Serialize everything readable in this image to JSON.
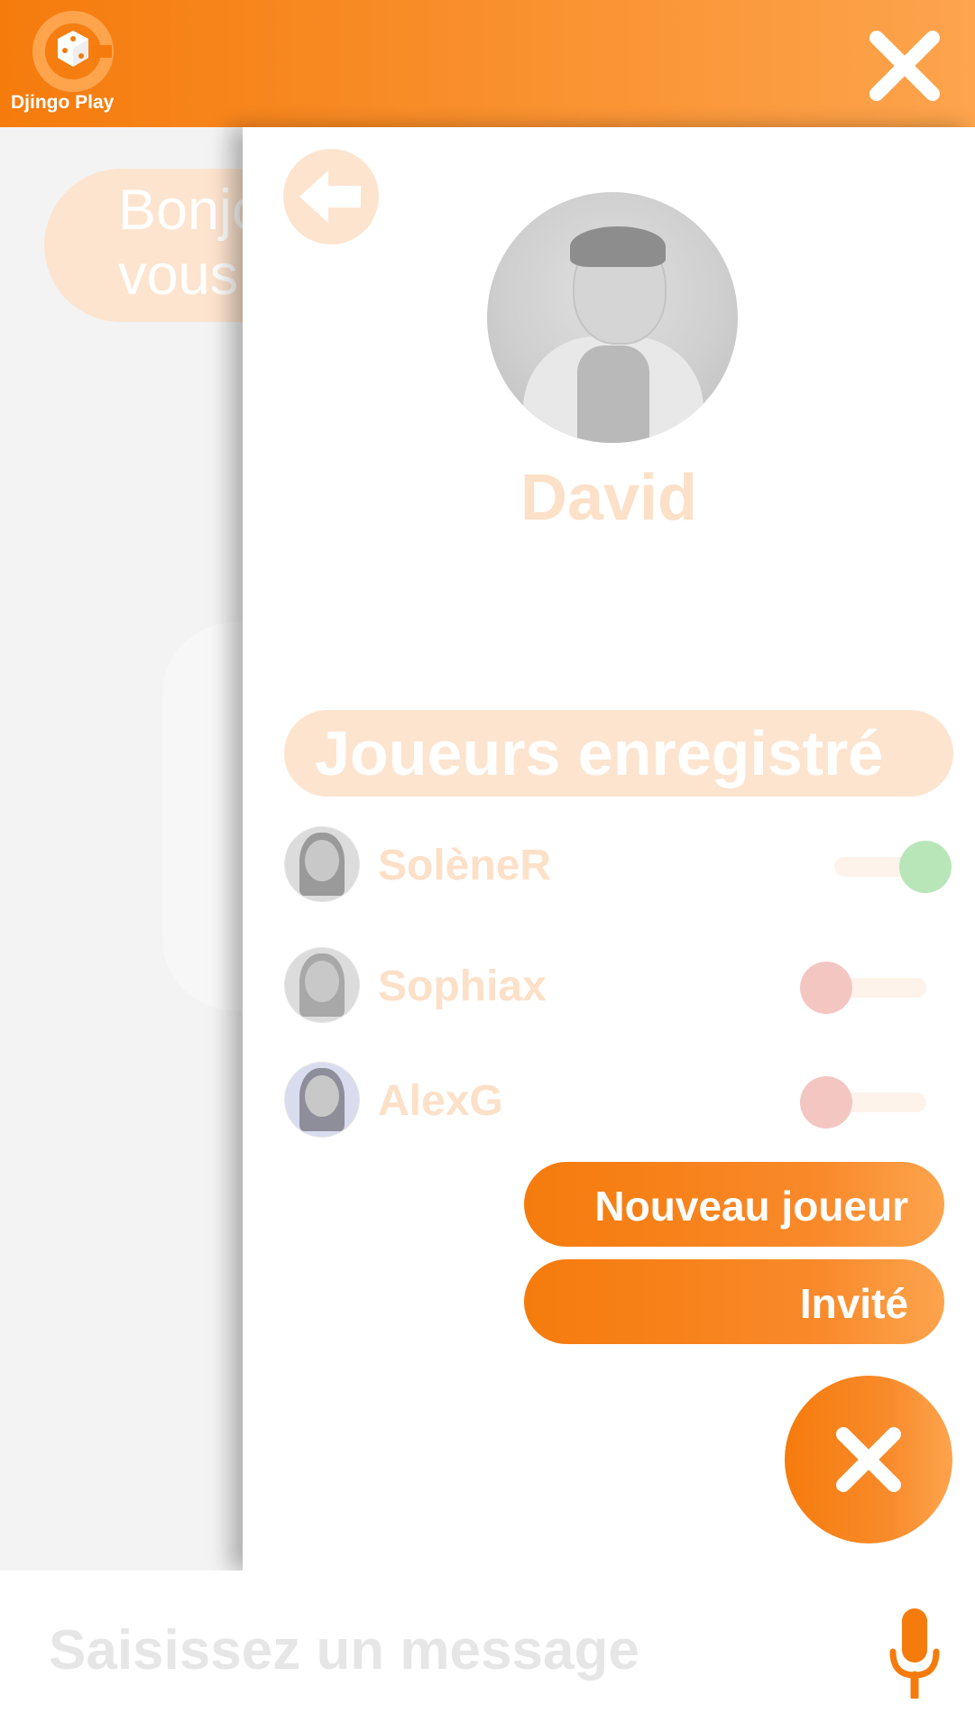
{
  "app": {
    "name": "Djingo Play",
    "brand_color": "#f57b0c",
    "brand_color_light": "#fda44d"
  },
  "chat": {
    "greeting": "Bonjour\nvous"
  },
  "profile": {
    "name": "David",
    "back_icon": "arrow-left-icon"
  },
  "players": {
    "section_title": "Joueurs enregistré",
    "items": [
      {
        "name": "SolèneR",
        "enabled": true,
        "status_color": "#b9e6b9"
      },
      {
        "name": "Sophiax",
        "enabled": false,
        "status_color": "#f4c6c2"
      },
      {
        "name": "AlexG",
        "enabled": false,
        "status_color": "#f4c6c2"
      }
    ]
  },
  "actions": {
    "new_player": "Nouveau joueur",
    "guest": "Invité"
  },
  "input": {
    "placeholder": "Saisissez un message"
  }
}
